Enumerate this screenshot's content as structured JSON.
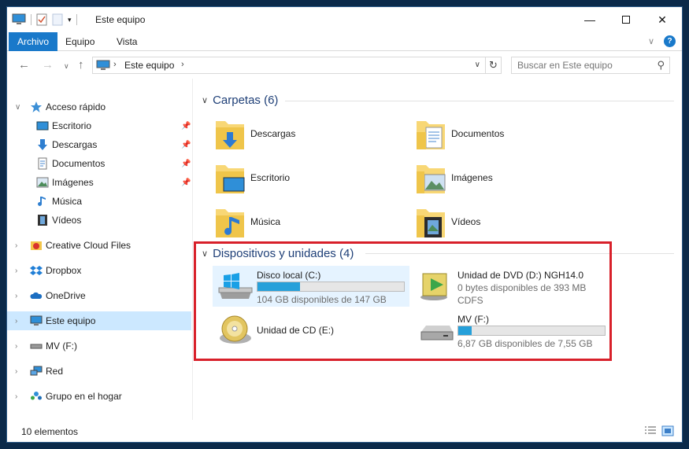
{
  "window": {
    "title": "Este equipo"
  },
  "ribbon": {
    "tabs": [
      "Archivo",
      "Equipo",
      "Vista"
    ]
  },
  "address": {
    "path": "Este equipo",
    "search_placeholder": "Buscar en Este equipo"
  },
  "sidebar": {
    "items": [
      {
        "label": "Acceso rápido",
        "icon": "star-icon"
      },
      {
        "label": "Escritorio",
        "icon": "desktop-icon",
        "pinned": true
      },
      {
        "label": "Descargas",
        "icon": "download-icon",
        "pinned": true
      },
      {
        "label": "Documentos",
        "icon": "document-icon",
        "pinned": true
      },
      {
        "label": "Imágenes",
        "icon": "pictures-icon",
        "pinned": true
      },
      {
        "label": "Música",
        "icon": "music-icon"
      },
      {
        "label": "Vídeos",
        "icon": "video-icon"
      },
      {
        "label": "Creative Cloud Files",
        "icon": "creative-cloud-icon"
      },
      {
        "label": "Dropbox",
        "icon": "dropbox-icon"
      },
      {
        "label": "OneDrive",
        "icon": "onedrive-icon"
      },
      {
        "label": "Este equipo",
        "icon": "computer-icon",
        "selected": true
      },
      {
        "label": "MV (F:)",
        "icon": "drive-icon"
      },
      {
        "label": "Red",
        "icon": "network-icon"
      },
      {
        "label": "Grupo en el hogar",
        "icon": "homegroup-icon"
      }
    ]
  },
  "folders": {
    "header": "Carpetas (6)",
    "items": [
      {
        "label": "Descargas",
        "icon": "download-folder-icon"
      },
      {
        "label": "Documentos",
        "icon": "documents-folder-icon"
      },
      {
        "label": "Escritorio",
        "icon": "desktop-folder-icon"
      },
      {
        "label": "Imágenes",
        "icon": "pictures-folder-icon"
      },
      {
        "label": "Música",
        "icon": "music-folder-icon"
      },
      {
        "label": "Vídeos",
        "icon": "videos-folder-icon"
      }
    ]
  },
  "devices": {
    "header": "Dispositivos y unidades (4)",
    "items": [
      {
        "label": "Disco local (C:)",
        "free": "104 GB disponibles de 147 GB",
        "used_fraction": 0.29,
        "icon": "windows-drive-icon"
      },
      {
        "label": "Unidad de DVD (D:) NGH14.0",
        "free": "0 bytes disponibles de 393 MB",
        "fs": "CDFS",
        "icon": "dvd-drive-icon"
      },
      {
        "label": "Unidad de CD (E:)",
        "icon": "cd-drive-icon"
      },
      {
        "label": "MV (F:)",
        "free": "6,87 GB disponibles de 7,55 GB",
        "used_fraction": 0.09,
        "icon": "removable-drive-icon"
      }
    ]
  },
  "status": {
    "count": "10 elementos"
  },
  "colors": {
    "accent": "#1979ca",
    "selection": "#cce8ff",
    "highlight_box": "#d8202a",
    "usage_bar": "#26a0da"
  }
}
